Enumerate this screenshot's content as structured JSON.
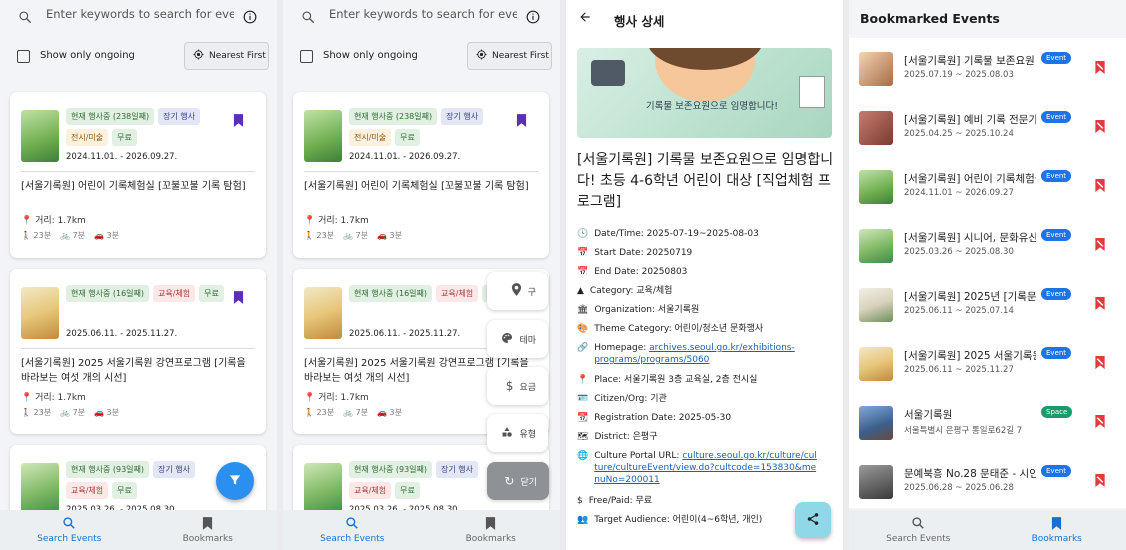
{
  "search": {
    "placeholder": "Enter keywords to search for eve…"
  },
  "filter": {
    "ongoing_label": "Show only ongoing",
    "sort_label": "Nearest First"
  },
  "cards": [
    {
      "badges": [
        "현재 행사중 (238일째)",
        "장기 행사",
        "전시/미술",
        "무료"
      ],
      "dates": "2024.11.01. - 2026.09.27.",
      "title": "[서울기록원] 어린이 기록체험실 [꼬불꼬불 기록 탐험]",
      "distance": "📍 거리: 1.7km",
      "walk": "23분",
      "bike": "7분",
      "car": "3분"
    },
    {
      "badges": [
        "현재 행사중 (16일째)",
        "교육/체험",
        "무료"
      ],
      "dates": "2025.06.11. - 2025.11.27.",
      "title": "[서울기록원] 2025 서울기록원 강연프로그램 [기록을 바라보는 여섯 개의 시선]",
      "distance": "📍 거리: 1.7km",
      "walk": "23분",
      "bike": "7분",
      "car": "3분"
    },
    {
      "badges": [
        "현재 행사중 (93일째)",
        "장기 행사",
        "교육/체험",
        "무료"
      ],
      "dates": "2025.03.26. - 2025.08.30.",
      "title": "",
      "distance": "",
      "walk": "",
      "bike": "",
      "car": ""
    }
  ],
  "nav": {
    "search_label": "Search Events",
    "bookmarks_label": "Bookmarks"
  },
  "fab_menu": {
    "district": "구",
    "theme": "테마",
    "fee": "요금",
    "type": "유형",
    "close": "닫기"
  },
  "detail": {
    "header": "행사 상세",
    "banner_text": "기록물 보존요원으로 임명합니다!",
    "title": "[서울기록원] 기록물 보존요원으로 임명합니다! 초등 4-6학년 어린이 대상 [직업체험 프로그램]",
    "rows": [
      "Date/Time: 2025-07-19~2025-08-03",
      "Start Date: 20250719",
      "End Date: 20250803",
      "Category: 교육/체험",
      "Organization: 서울기록원",
      "Theme Category: 어린이/청소년 문화행사"
    ],
    "homepage_label": "Homepage: ",
    "homepage_url": "archives.seoul.go.kr/exhibitions-programs/programs/5060",
    "place": "Place: 서울기록원 3층 교육실, 2층 전시실",
    "citizen": "Citizen/Org: 기관",
    "registration": "Registration Date: 2025-05-30",
    "district": "District: 은평구",
    "portal_label": "Culture Portal URL: ",
    "portal_url": "culture.seoul.go.kr/culture/culture/cultureEvent/view.do?cultcode=153830&menuNo=200011",
    "fee": "Free/Paid: 무료",
    "audience": "Target Audience: 어린이(4~6학년, 개인)"
  },
  "bookmarks": {
    "header": "Bookmarked Events",
    "items": [
      {
        "title": "[서울기록원] 기록물 보존요원",
        "dates": "2025.07.19 ~ 2025.08.03",
        "tag": "Event"
      },
      {
        "title": "[서울기록원] 예비 기록 전문가",
        "dates": "2025.04.25 ~ 2025.10.24",
        "tag": "Event"
      },
      {
        "title": "[서울기록원] 어린이 기록체험실",
        "dates": "2024.11.01 ~ 2026.09.27",
        "tag": "Event"
      },
      {
        "title": "[서울기록원] 시니어, 문화유산",
        "dates": "2025.03.26 ~ 2025.08.30",
        "tag": "Event"
      },
      {
        "title": "[서울기록원] 2025년 [기록문화",
        "dates": "2025.06.11 ~ 2025.07.14",
        "tag": "Event"
      },
      {
        "title": "[서울기록원] 2025 서울기록원",
        "dates": "2025.06.11 ~ 2025.11.27",
        "tag": "Event"
      },
      {
        "title": "서울기록원",
        "dates": "서울특별시 은평구 통일로62길 7",
        "tag": "Space"
      },
      {
        "title": "문예북흥 No.28 문태준 - 시인",
        "dates": "2025.06.28 ~ 2025.06.28",
        "tag": "Event"
      }
    ]
  },
  "colors": {
    "accent": "#1a6fd0",
    "fab": "#2b8ff0",
    "bookmark": "#5b2fb6",
    "remove": "#e5393e",
    "event_tag": "#1e73e8",
    "space_tag": "#1b9a6a"
  }
}
